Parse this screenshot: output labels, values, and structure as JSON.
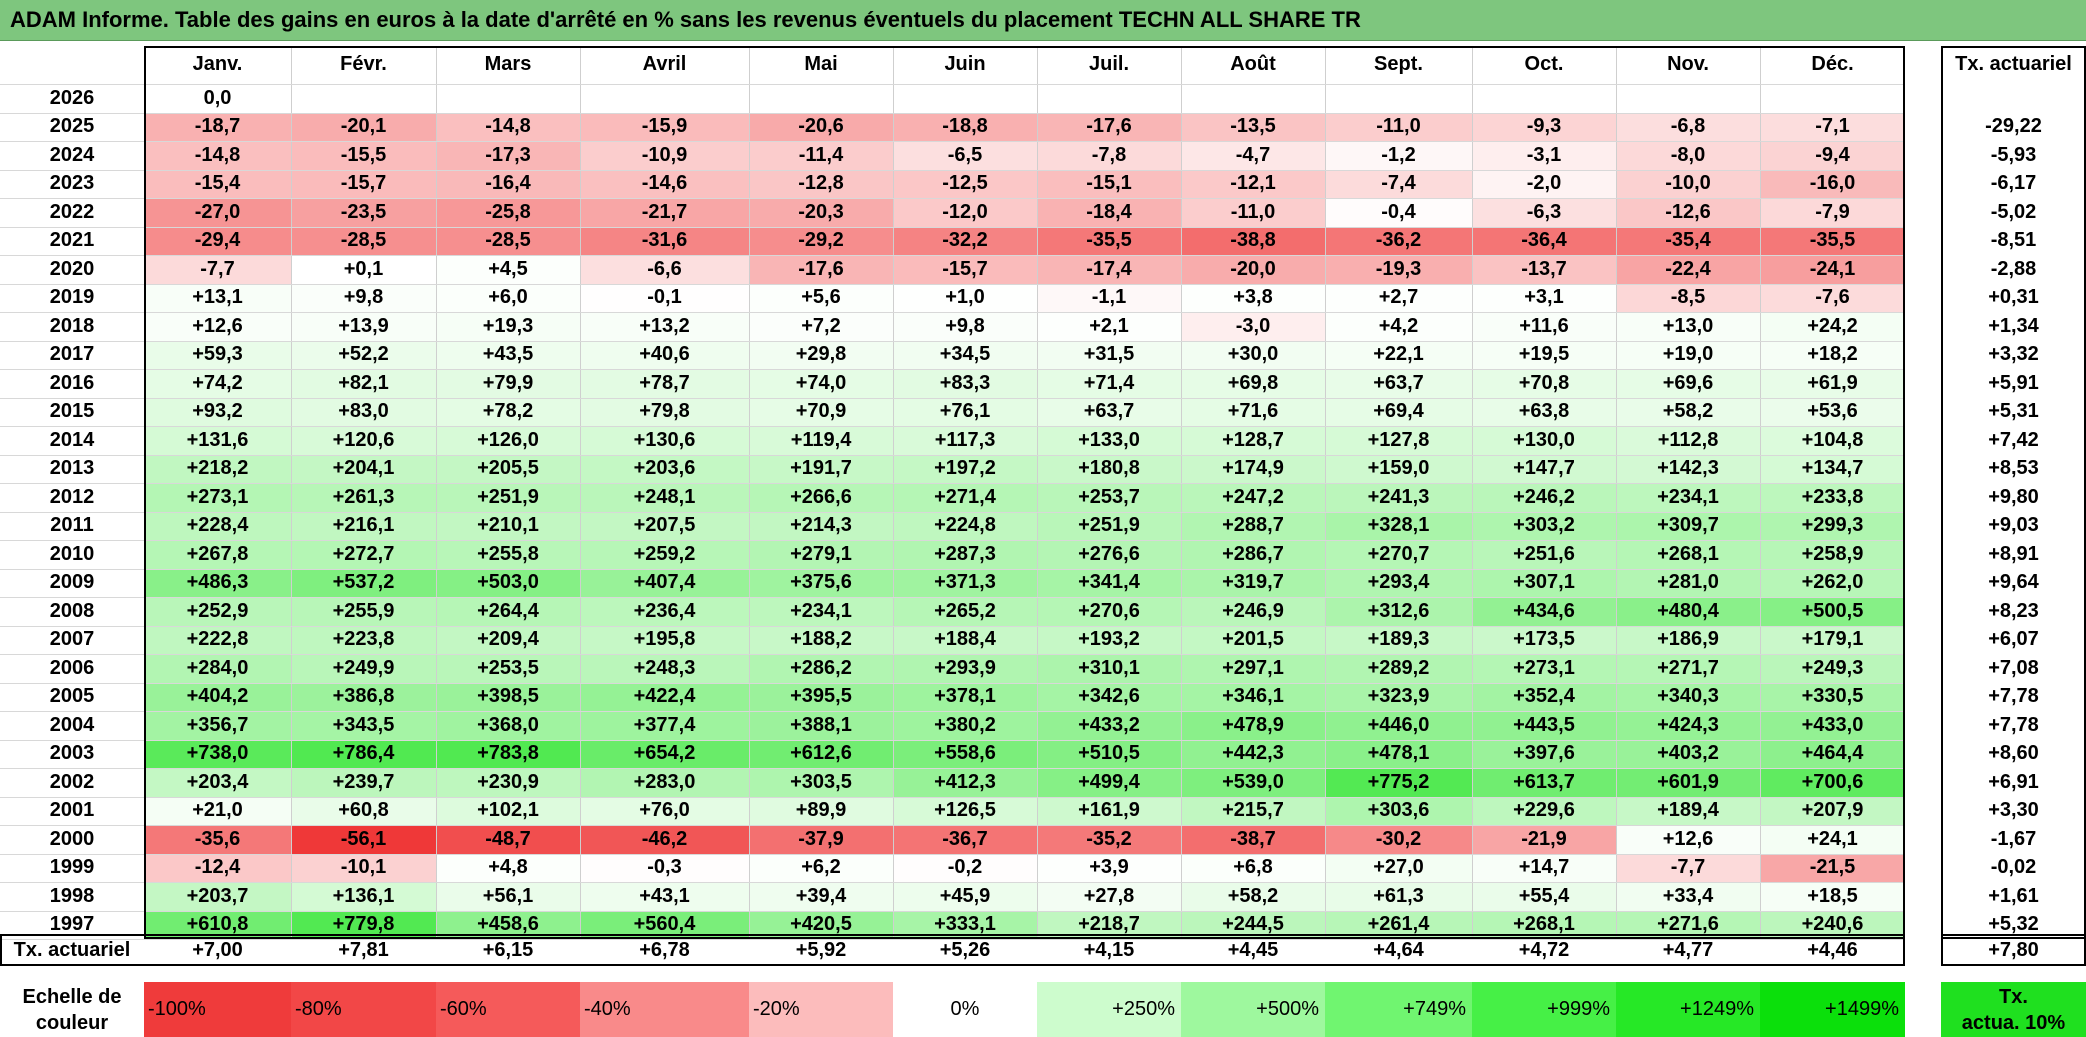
{
  "title": "ADAM Informe. Table des gains en euros à la date d'arrêté en % sans les revenus éventuels du placement TECHN ALL SHARE TR",
  "chart_data": {
    "type": "table",
    "months": [
      "Janv.",
      "Févr.",
      "Mars",
      "Avril",
      "Mai",
      "Juin",
      "Juil.",
      "Août",
      "Sept.",
      "Oct.",
      "Nov.",
      "Déc."
    ],
    "annual_header": "Tx. actuariel",
    "rows": [
      {
        "year": "2026",
        "values": [
          "0,0",
          "",
          "",
          "",
          "",
          "",
          "",
          "",
          "",
          "",
          "",
          ""
        ],
        "rate": ""
      },
      {
        "year": "2025",
        "values": [
          "-18,7",
          "-20,1",
          "-14,8",
          "-15,9",
          "-20,6",
          "-18,8",
          "-17,6",
          "-13,5",
          "-11,0",
          "-9,3",
          "-6,8",
          "-7,1"
        ],
        "rate": "-29,22"
      },
      {
        "year": "2024",
        "values": [
          "-14,8",
          "-15,5",
          "-17,3",
          "-10,9",
          "-11,4",
          "-6,5",
          "-7,8",
          "-4,7",
          "-1,2",
          "-3,1",
          "-8,0",
          "-9,4"
        ],
        "rate": "-5,93"
      },
      {
        "year": "2023",
        "values": [
          "-15,4",
          "-15,7",
          "-16,4",
          "-14,6",
          "-12,8",
          "-12,5",
          "-15,1",
          "-12,1",
          "-7,4",
          "-2,0",
          "-10,0",
          "-16,0"
        ],
        "rate": "-6,17"
      },
      {
        "year": "2022",
        "values": [
          "-27,0",
          "-23,5",
          "-25,8",
          "-21,7",
          "-20,3",
          "-12,0",
          "-18,4",
          "-11,0",
          "-0,4",
          "-6,3",
          "-12,6",
          "-7,9"
        ],
        "rate": "-5,02"
      },
      {
        "year": "2021",
        "values": [
          "-29,4",
          "-28,5",
          "-28,5",
          "-31,6",
          "-29,2",
          "-32,2",
          "-35,5",
          "-38,8",
          "-36,2",
          "-36,4",
          "-35,4",
          "-35,5"
        ],
        "rate": "-8,51"
      },
      {
        "year": "2020",
        "values": [
          "-7,7",
          "+0,1",
          "+4,5",
          "-6,6",
          "-17,6",
          "-15,7",
          "-17,4",
          "-20,0",
          "-19,3",
          "-13,7",
          "-22,4",
          "-24,1"
        ],
        "rate": "-2,88"
      },
      {
        "year": "2019",
        "values": [
          "+13,1",
          "+9,8",
          "+6,0",
          "-0,1",
          "+5,6",
          "+1,0",
          "-1,1",
          "+3,8",
          "+2,7",
          "+3,1",
          "-8,5",
          "-7,6"
        ],
        "rate": "+0,31"
      },
      {
        "year": "2018",
        "values": [
          "+12,6",
          "+13,9",
          "+19,3",
          "+13,2",
          "+7,2",
          "+9,8",
          "+2,1",
          "-3,0",
          "+4,2",
          "+11,6",
          "+13,0",
          "+24,2"
        ],
        "rate": "+1,34"
      },
      {
        "year": "2017",
        "values": [
          "+59,3",
          "+52,2",
          "+43,5",
          "+40,6",
          "+29,8",
          "+34,5",
          "+31,5",
          "+30,0",
          "+22,1",
          "+19,5",
          "+19,0",
          "+18,2"
        ],
        "rate": "+3,32"
      },
      {
        "year": "2016",
        "values": [
          "+74,2",
          "+82,1",
          "+79,9",
          "+78,7",
          "+74,0",
          "+83,3",
          "+71,4",
          "+69,8",
          "+63,7",
          "+70,8",
          "+69,6",
          "+61,9"
        ],
        "rate": "+5,91"
      },
      {
        "year": "2015",
        "values": [
          "+93,2",
          "+83,0",
          "+78,2",
          "+79,8",
          "+70,9",
          "+76,1",
          "+63,7",
          "+71,6",
          "+69,4",
          "+63,8",
          "+58,2",
          "+53,6"
        ],
        "rate": "+5,31"
      },
      {
        "year": "2014",
        "values": [
          "+131,6",
          "+120,6",
          "+126,0",
          "+130,6",
          "+119,4",
          "+117,3",
          "+133,0",
          "+128,7",
          "+127,8",
          "+130,0",
          "+112,8",
          "+104,8"
        ],
        "rate": "+7,42"
      },
      {
        "year": "2013",
        "values": [
          "+218,2",
          "+204,1",
          "+205,5",
          "+203,6",
          "+191,7",
          "+197,2",
          "+180,8",
          "+174,9",
          "+159,0",
          "+147,7",
          "+142,3",
          "+134,7"
        ],
        "rate": "+8,53"
      },
      {
        "year": "2012",
        "values": [
          "+273,1",
          "+261,3",
          "+251,9",
          "+248,1",
          "+266,6",
          "+271,4",
          "+253,7",
          "+247,2",
          "+241,3",
          "+246,2",
          "+234,1",
          "+233,8"
        ],
        "rate": "+9,80"
      },
      {
        "year": "2011",
        "values": [
          "+228,4",
          "+216,1",
          "+210,1",
          "+207,5",
          "+214,3",
          "+224,8",
          "+251,9",
          "+288,7",
          "+328,1",
          "+303,2",
          "+309,7",
          "+299,3"
        ],
        "rate": "+9,03"
      },
      {
        "year": "2010",
        "values": [
          "+267,8",
          "+272,7",
          "+255,8",
          "+259,2",
          "+279,1",
          "+287,3",
          "+276,6",
          "+286,7",
          "+270,7",
          "+251,6",
          "+268,1",
          "+258,9"
        ],
        "rate": "+8,91"
      },
      {
        "year": "2009",
        "values": [
          "+486,3",
          "+537,2",
          "+503,0",
          "+407,4",
          "+375,6",
          "+371,3",
          "+341,4",
          "+319,7",
          "+293,4",
          "+307,1",
          "+281,0",
          "+262,0"
        ],
        "rate": "+9,64"
      },
      {
        "year": "2008",
        "values": [
          "+252,9",
          "+255,9",
          "+264,4",
          "+236,4",
          "+234,1",
          "+265,2",
          "+270,6",
          "+246,9",
          "+312,6",
          "+434,6",
          "+480,4",
          "+500,5"
        ],
        "rate": "+8,23"
      },
      {
        "year": "2007",
        "values": [
          "+222,8",
          "+223,8",
          "+209,4",
          "+195,8",
          "+188,2",
          "+188,4",
          "+193,2",
          "+201,5",
          "+189,3",
          "+173,5",
          "+186,9",
          "+179,1"
        ],
        "rate": "+6,07"
      },
      {
        "year": "2006",
        "values": [
          "+284,0",
          "+249,9",
          "+253,5",
          "+248,3",
          "+286,2",
          "+293,9",
          "+310,1",
          "+297,1",
          "+289,2",
          "+273,1",
          "+271,7",
          "+249,3"
        ],
        "rate": "+7,08"
      },
      {
        "year": "2005",
        "values": [
          "+404,2",
          "+386,8",
          "+398,5",
          "+422,4",
          "+395,5",
          "+378,1",
          "+342,6",
          "+346,1",
          "+323,9",
          "+352,4",
          "+340,3",
          "+330,5"
        ],
        "rate": "+7,78"
      },
      {
        "year": "2004",
        "values": [
          "+356,7",
          "+343,5",
          "+368,0",
          "+377,4",
          "+388,1",
          "+380,2",
          "+433,2",
          "+478,9",
          "+446,0",
          "+443,5",
          "+424,3",
          "+433,0"
        ],
        "rate": "+7,78"
      },
      {
        "year": "2003",
        "values": [
          "+738,0",
          "+786,4",
          "+783,8",
          "+654,2",
          "+612,6",
          "+558,6",
          "+510,5",
          "+442,3",
          "+478,1",
          "+397,6",
          "+403,2",
          "+464,4"
        ],
        "rate": "+8,60"
      },
      {
        "year": "2002",
        "values": [
          "+203,4",
          "+239,7",
          "+230,9",
          "+283,0",
          "+303,5",
          "+412,3",
          "+499,4",
          "+539,0",
          "+775,2",
          "+613,7",
          "+601,9",
          "+700,6"
        ],
        "rate": "+6,91"
      },
      {
        "year": "2001",
        "values": [
          "+21,0",
          "+60,8",
          "+102,1",
          "+76,0",
          "+89,9",
          "+126,5",
          "+161,9",
          "+215,7",
          "+303,6",
          "+229,6",
          "+189,4",
          "+207,9"
        ],
        "rate": "+3,30"
      },
      {
        "year": "2000",
        "values": [
          "-35,6",
          "-56,1",
          "-48,7",
          "-46,2",
          "-37,9",
          "-36,7",
          "-35,2",
          "-38,7",
          "-30,2",
          "-21,9",
          "+12,6",
          "+24,1"
        ],
        "rate": "-1,67"
      },
      {
        "year": "1999",
        "values": [
          "-12,4",
          "-10,1",
          "+4,8",
          "-0,3",
          "+6,2",
          "-0,2",
          "+3,9",
          "+6,8",
          "+27,0",
          "+14,7",
          "-7,7",
          "-21,5"
        ],
        "rate": "-0,02"
      },
      {
        "year": "1998",
        "values": [
          "+203,7",
          "+136,1",
          "+56,1",
          "+43,1",
          "+39,4",
          "+45,9",
          "+27,8",
          "+58,2",
          "+61,3",
          "+55,4",
          "+33,4",
          "+18,5"
        ],
        "rate": "+1,61"
      },
      {
        "year": "1997",
        "values": [
          "+610,8",
          "+779,8",
          "+458,6",
          "+560,4",
          "+420,5",
          "+333,1",
          "+218,7",
          "+244,5",
          "+261,4",
          "+268,1",
          "+271,6",
          "+240,6"
        ],
        "rate": "+5,32"
      }
    ],
    "footer": {
      "label": "Tx. actuariel",
      "values": [
        "+7,00",
        "+7,81",
        "+6,15",
        "+6,78",
        "+5,92",
        "+5,26",
        "+4,15",
        "+4,45",
        "+4,64",
        "+4,72",
        "+4,77",
        "+4,46"
      ],
      "overall": "+7,80"
    },
    "scale": {
      "label_line1": "Echelle de",
      "label_line2": "couleur",
      "steps": [
        {
          "label": "-100%",
          "value": -100,
          "color": "#ef3b3b"
        },
        {
          "label": "-80%",
          "value": -80,
          "color": "#f24747"
        },
        {
          "label": "-60%",
          "value": -60,
          "color": "#f55a5a"
        },
        {
          "label": "-40%",
          "value": -40,
          "color": "#f98a8a"
        },
        {
          "label": "-20%",
          "value": -20,
          "color": "#fcbcbc"
        },
        {
          "label": "0%",
          "value": 0,
          "color": "#ffffff"
        },
        {
          "label": "+250%",
          "value": 250,
          "color": "#cdfccd"
        },
        {
          "label": "+500%",
          "value": 500,
          "color": "#9ef89e"
        },
        {
          "label": "+749%",
          "value": 749,
          "color": "#70f570"
        },
        {
          "label": "+999%",
          "value": 999,
          "color": "#46f046"
        },
        {
          "label": "+1249%",
          "value": 1249,
          "color": "#26e826"
        },
        {
          "label": "+1499%",
          "value": 1499,
          "color": "#0be00b"
        }
      ],
      "rate_label_line1": "Tx.",
      "rate_label_line2": "actua. 10%",
      "rate_color": "#1fe01f"
    },
    "colors": {
      "title_bar": "#7ec67e",
      "negative_max": "#ee2c2c",
      "positive_max": "#0be00b",
      "neutral": "#ffffff"
    }
  }
}
